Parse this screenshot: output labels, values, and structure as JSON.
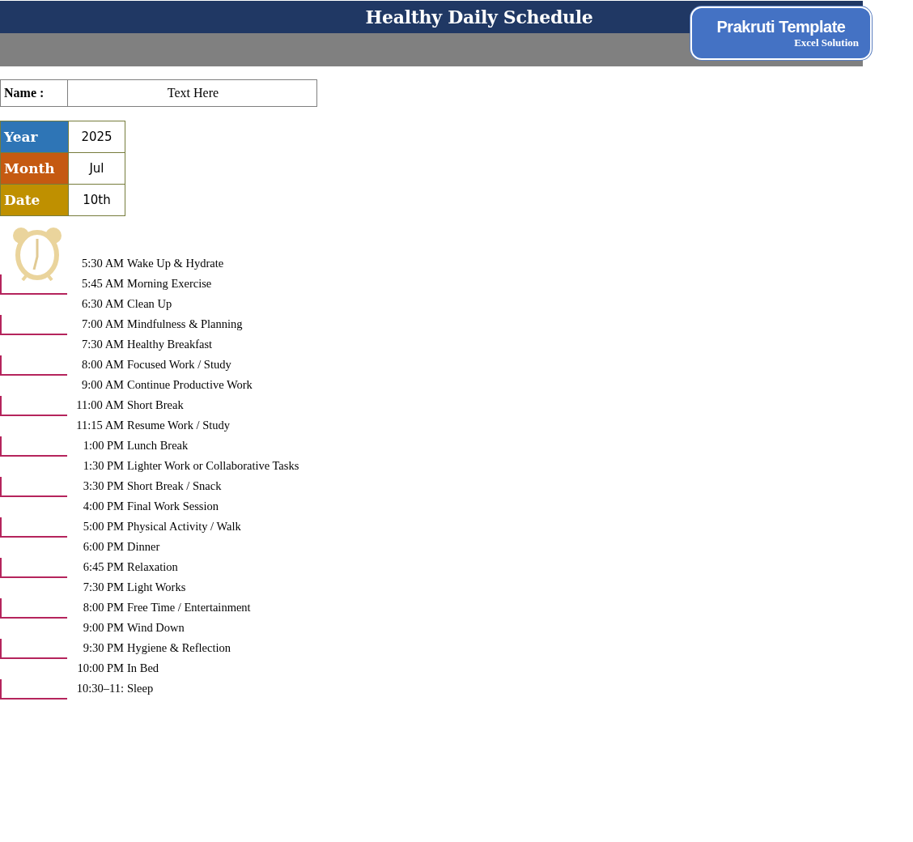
{
  "header": {
    "title": "Healthy Daily Schedule",
    "logo": {
      "name": "Prakruti Template",
      "tagline": "Excel Solution"
    }
  },
  "name_field": {
    "label": "Name :",
    "value": "Text Here"
  },
  "date_fields": [
    {
      "label": "Year",
      "value": "2025",
      "color": "#2e75b6"
    },
    {
      "label": "Month",
      "value": "Jul",
      "color": "#c55a11"
    },
    {
      "label": "Date",
      "value": "10th",
      "color": "#bf9000"
    }
  ],
  "schedule": [
    {
      "time": "5:30 AM",
      "activity": "Wake Up & Hydrate"
    },
    {
      "time": "5:45 AM",
      "activity": "Morning Exercise"
    },
    {
      "time": "6:30 AM",
      "activity": "Clean Up"
    },
    {
      "time": "7:00 AM",
      "activity": "Mindfulness & Planning"
    },
    {
      "time": "7:30 AM",
      "activity": "Healthy Breakfast"
    },
    {
      "time": "8:00 AM",
      "activity": "Focused Work / Study"
    },
    {
      "time": "9:00 AM",
      "activity": "Continue Productive Work"
    },
    {
      "time": "11:00 AM",
      "activity": "Short Break"
    },
    {
      "time": "11:15 AM",
      "activity": "Resume Work / Study"
    },
    {
      "time": "1:00 PM",
      "activity": "Lunch Break"
    },
    {
      "time": "1:30 PM",
      "activity": "Lighter Work or Collaborative Tasks"
    },
    {
      "time": "3:30 PM",
      "activity": "Short Break / Snack"
    },
    {
      "time": "4:00 PM",
      "activity": "Final Work Session"
    },
    {
      "time": "5:00 PM",
      "activity": "Physical Activity / Walk"
    },
    {
      "time": "6:00 PM",
      "activity": "Dinner"
    },
    {
      "time": "6:45 PM",
      "activity": "Relaxation"
    },
    {
      "time": "7:30 PM",
      "activity": "Light Works"
    },
    {
      "time": "8:00 PM",
      "activity": "Free Time / Entertainment"
    },
    {
      "time": "9:00 PM",
      "activity": "Wind Down"
    },
    {
      "time": "9:30 PM",
      "activity": "Hygiene & Reflection"
    },
    {
      "time": "10:00 PM",
      "activity": "In Bed"
    },
    {
      "time": "10:30–11:",
      "activity": "Sleep"
    }
  ]
}
